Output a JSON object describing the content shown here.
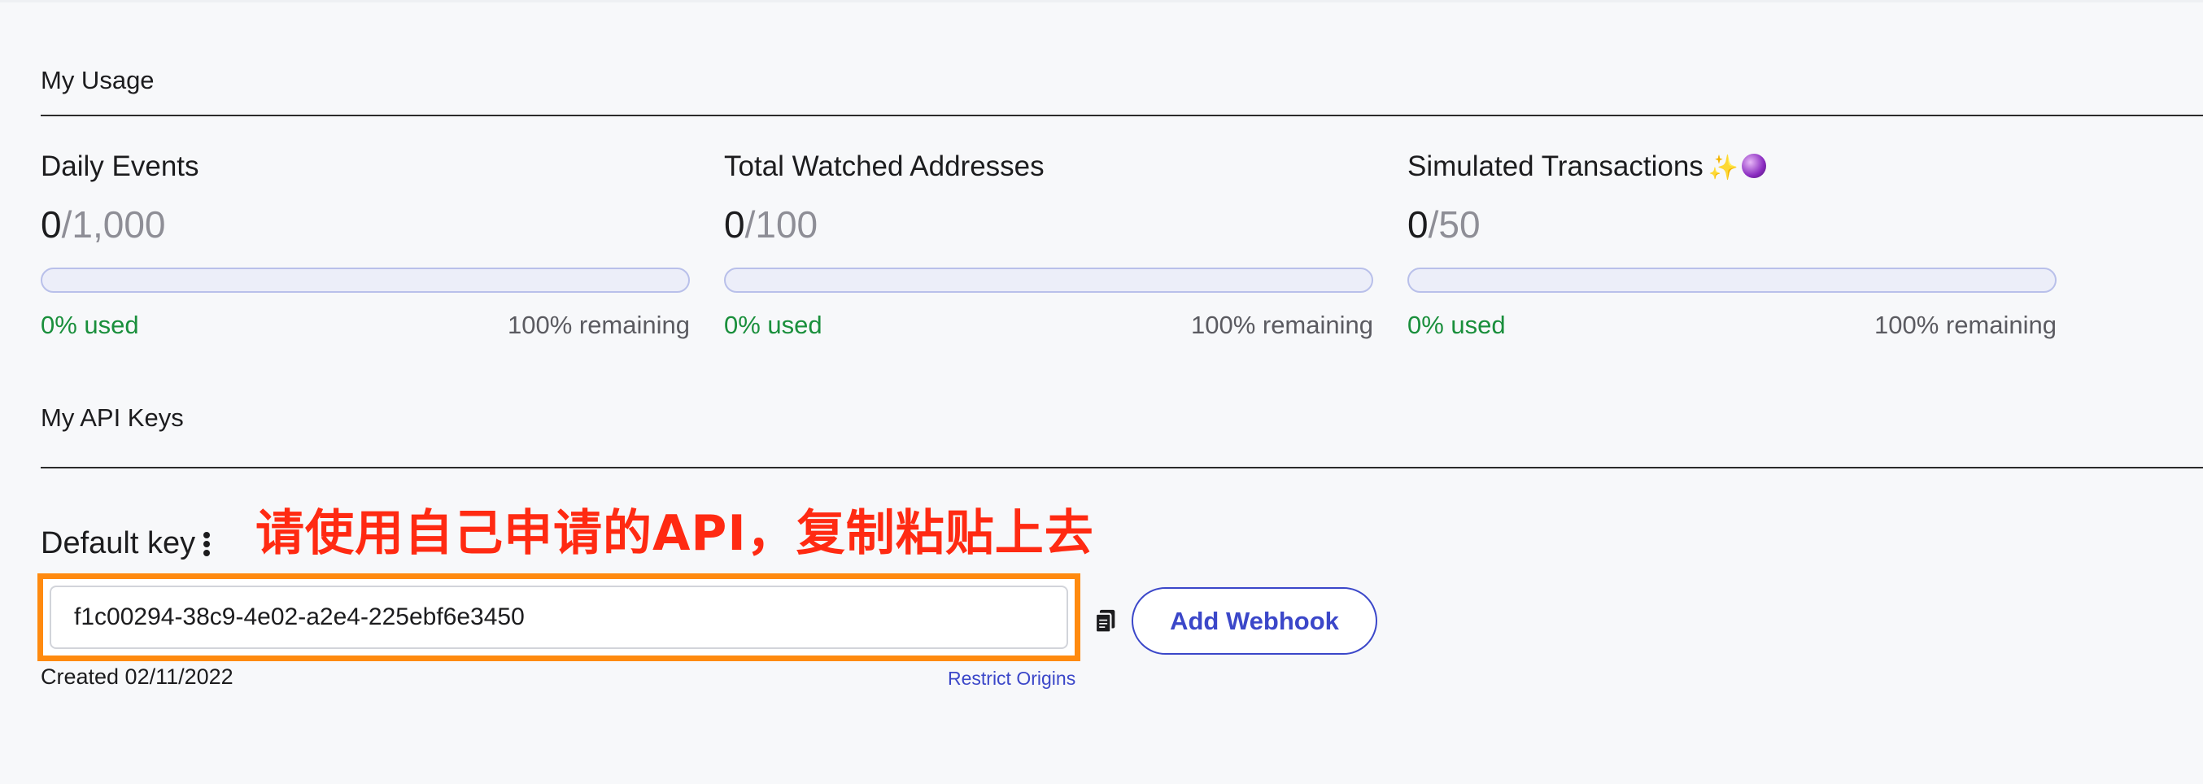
{
  "usage": {
    "title": "My Usage",
    "stats": [
      {
        "label": "Daily Events",
        "current": "0",
        "limit": "/1,000",
        "used_text": "0% used",
        "remaining_text": "100% remaining",
        "used_fraction": 0
      },
      {
        "label": "Total Watched Addresses",
        "current": "0",
        "limit": "/100",
        "used_text": "0% used",
        "remaining_text": "100% remaining",
        "used_fraction": 0
      },
      {
        "label": "Simulated Transactions",
        "current": "0",
        "limit": "/50",
        "used_text": "0% used",
        "remaining_text": "100% remaining",
        "used_fraction": 0,
        "icons": [
          "sparkles-icon",
          "crystal-ball-icon"
        ]
      }
    ]
  },
  "api_keys": {
    "title": "My API Keys",
    "default_key": {
      "label": "Default key",
      "value": "f1c00294-38c9-4e02-a2e4-225ebf6e3450",
      "created": "Created 02/11/2022",
      "restrict_link": "Restrict Origins",
      "add_webhook_label": "Add Webhook"
    }
  },
  "annotation": {
    "text": "请使用自己申请的API，复制粘贴上去",
    "color": "#ff2a12",
    "highlight_color": "#ff8a0f"
  },
  "colors": {
    "accent": "#3b47c9",
    "used_green": "#1a8f3c",
    "bar_border": "#b9c0ea"
  }
}
